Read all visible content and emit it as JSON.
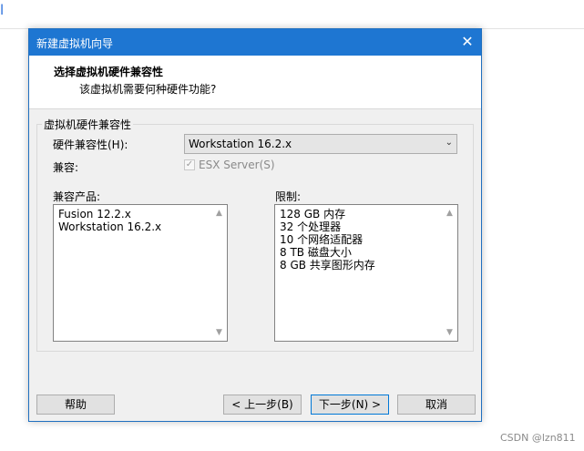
{
  "background": {
    "glyph": "l",
    "watermark": "CSDN @lzn811"
  },
  "dialog": {
    "title": "新建虚拟机向导",
    "close": "✕",
    "header_title": "选择虚拟机硬件兼容性",
    "header_subtitle": "该虚拟机需要何种硬件功能?",
    "group_title": "虚拟机硬件兼容性",
    "hw_compat_label": "硬件兼容性(H):",
    "hw_compat_value": "Workstation 16.2.x",
    "compatible_label": "兼容:",
    "esx_checkbox_label": "ESX Server(S)",
    "esx_checked": true,
    "compatible_products_label": "兼容产品:",
    "compatible_products": [
      "Fusion 12.2.x",
      "Workstation 16.2.x"
    ],
    "limits_label": "限制:",
    "limits": [
      "128 GB 内存",
      "32 个处理器",
      "10 个网络适配器",
      "8 TB 磁盘大小",
      "8 GB 共享图形内存"
    ],
    "buttons": {
      "help": "帮助",
      "back": "< 上一步(B)",
      "next": "下一步(N) >",
      "cancel": "取消"
    }
  }
}
